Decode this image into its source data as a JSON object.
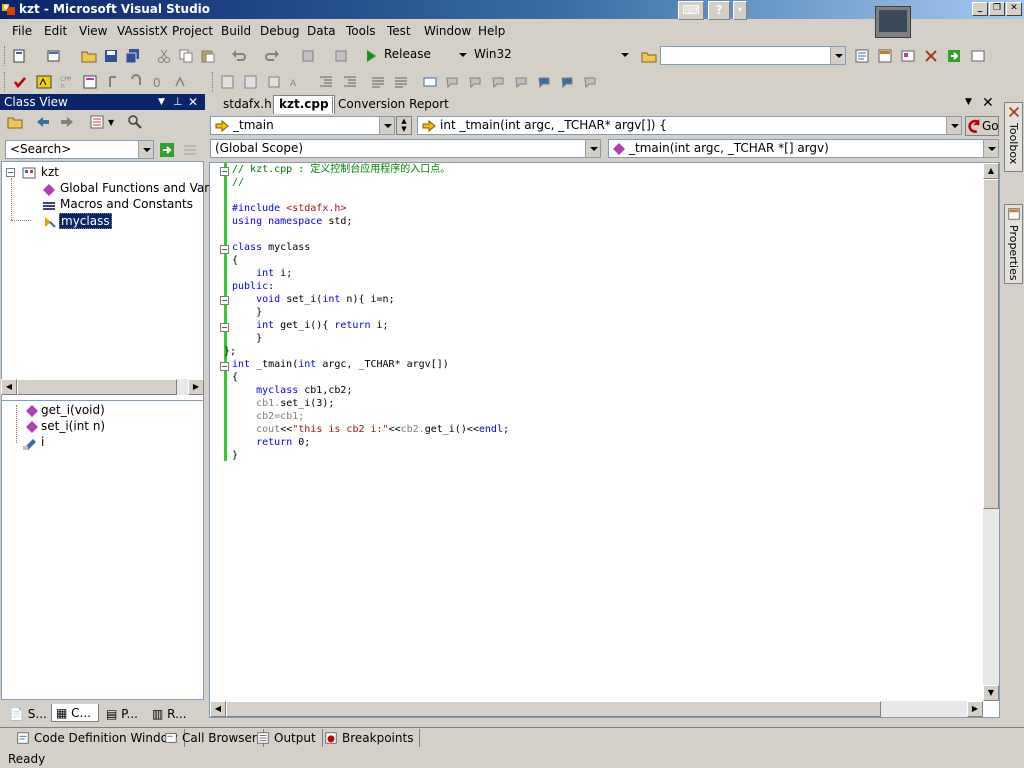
{
  "window": {
    "title": "kzt - Microsoft Visual Studio"
  },
  "menu": [
    "File",
    "Edit",
    "View",
    "VAssistX",
    "Project",
    "Build",
    "Debug",
    "Data",
    "Tools",
    "Test",
    "Window",
    "Help"
  ],
  "toolbar": {
    "config": "Release",
    "platform": "Win32",
    "find_value": ""
  },
  "class_view": {
    "title": "Class View",
    "search_placeholder": "<Search>",
    "tree": {
      "root": "kzt",
      "children": [
        "Global Functions and Variables",
        "Macros and Constants",
        "myclass"
      ]
    },
    "members": [
      "get_i(void)",
      "set_i(int n)",
      "i"
    ],
    "tabs": [
      "S...",
      "C...",
      "P...",
      "R..."
    ]
  },
  "editor": {
    "tabs": [
      "stdafx.h",
      "kzt.cpp",
      "Conversion Report"
    ],
    "nav_left": "_tmain",
    "nav_right": "int _tmain(int argc, _TCHAR* argv[]) {",
    "go_label": "Go",
    "scope_left": "(Global Scope)",
    "scope_right": "_tmain(int argc, _TCHAR *[] argv)"
  },
  "right_dock": {
    "toolbox": "Toolbox",
    "properties": "Properties"
  },
  "bottom_tabs": [
    "Code Definition Window",
    "Call Browser",
    "Output",
    "Breakpoints"
  ],
  "status": {
    "text": "Ready"
  },
  "colors": {
    "titlebar": "#0a246a",
    "selection": "#0a246a",
    "comment": "#008000",
    "keyword": "#0000ff",
    "change_bar": "#33cc33"
  }
}
